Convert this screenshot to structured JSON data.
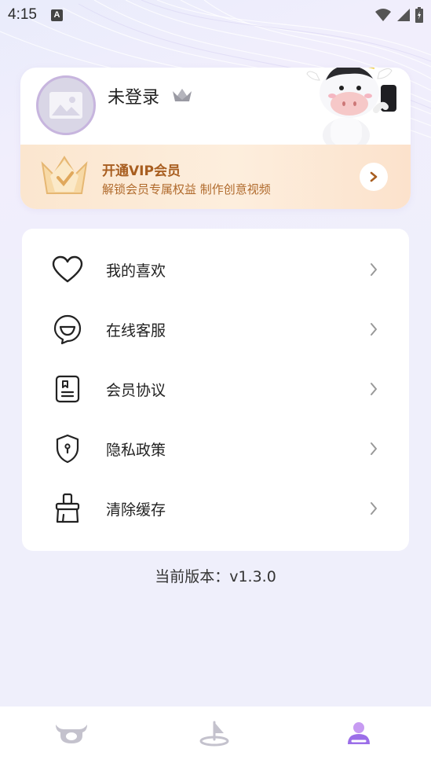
{
  "status_bar": {
    "time": "4:15",
    "notification_badge": "A"
  },
  "profile": {
    "username": "未登录",
    "avatar_icon": "image-placeholder-icon",
    "crown_icon": "crown-icon"
  },
  "vip": {
    "title": "开通VIP会员",
    "subtitle": "解锁会员专属权益 制作创意视频",
    "arrow_icon": "chevron-right-icon"
  },
  "menu": {
    "items": [
      {
        "label": "我的喜欢",
        "icon": "heart-icon"
      },
      {
        "label": "在线客服",
        "icon": "chat-bubble-icon"
      },
      {
        "label": "会员协议",
        "icon": "document-icon"
      },
      {
        "label": "隐私政策",
        "icon": "shield-icon"
      },
      {
        "label": "清除缓存",
        "icon": "broom-icon"
      }
    ]
  },
  "version_text": "当前版本：v1.3.0",
  "bottom_nav": {
    "items": [
      {
        "icon": "cow-home-icon",
        "active": false
      },
      {
        "icon": "create-flag-icon",
        "active": false
      },
      {
        "icon": "profile-icon",
        "active": true
      }
    ]
  },
  "colors": {
    "accent": "#9b6ee8",
    "vip_text": "#a85e20",
    "background": "#efeffb"
  }
}
